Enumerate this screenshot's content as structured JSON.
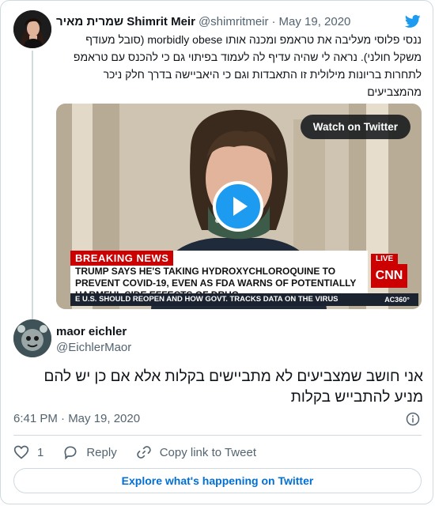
{
  "quoted_tweet": {
    "name": "שמרית מאיר Shimrit Meir",
    "handle": "@shimritmeir",
    "separator": "·",
    "date": "May 19, 2020",
    "text": "ננסי פלוסי מעליבה את טראמפ ומכנה אותו morbidly obese (סובל מעודף משקל חולני). נראה לי שהיה עדיף לה לעמוד בפיתוי גם כי להכנס עם טראמפ לתחרות בריונות מילולית זו התאבדות וגם כי היאביישה בדרך חלק ניכר מהמצביעים",
    "video": {
      "watch_label": "Watch on Twitter",
      "breaking_label": "BREAKING NEWS",
      "headline": "TRUMP SAYS HE'S TAKING HYDROXYCHLOROQUINE TO PREVENT COVID-19, EVEN AS FDA WARNS OF POTENTIALLY HARMFUL SIDE EFFECTS OF DRUG",
      "live_label": "LIVE",
      "network_logo": "CNN",
      "ticker": "E U.S. SHOULD REOPEN AND HOW GOVT. TRACKS DATA ON THE VIRUS",
      "show_tag": "AC360°"
    }
  },
  "reply_tweet": {
    "name": "maor eichler",
    "handle": "@EichlerMaor",
    "text": "אני חושב שמצביעים לא מתביישים בקלות אלא אם כן יש להם מניע להתבייש בקלות",
    "time": "6:41 PM · May 19, 2020"
  },
  "actions": {
    "like_count": "1",
    "reply_label": "Reply",
    "copy_label": "Copy link to Tweet"
  },
  "explore_label": "Explore what's happening on Twitter",
  "colors": {
    "twitter_blue": "#1d9bf0",
    "link_blue": "#006fd6",
    "muted": "#536471",
    "border": "#cfd9de",
    "breaking_red": "#cc0000"
  }
}
